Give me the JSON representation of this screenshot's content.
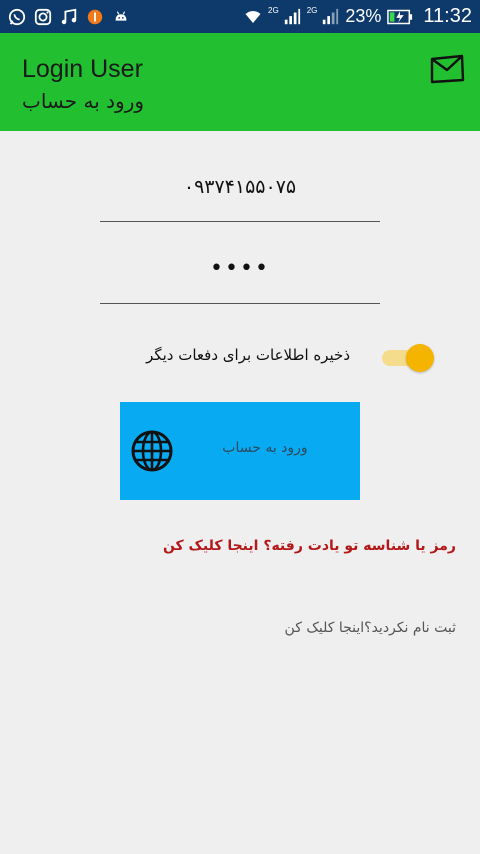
{
  "status_bar": {
    "battery_percent": "23%",
    "time": "11:32",
    "network_labels": [
      "2G",
      "2G"
    ],
    "left_icons": [
      "whatsapp-icon",
      "instagram-icon",
      "music-icon",
      "notification-badge-icon",
      "android-icon"
    ],
    "right_icons": [
      "wifi-icon",
      "signal-icon",
      "signal-icon",
      "battery-charging-icon"
    ]
  },
  "app_bar": {
    "title": "Login User",
    "subtitle": "ورود به حساب",
    "action_icon": "mail-icon",
    "color": "#22c030"
  },
  "form": {
    "phone_value": "۰۹۳۷۴۱۵۵۰۷۵",
    "password_value": "••••",
    "remember_label": "ذخیره اطلاعات برای دفعات دیگر",
    "remember_on": true,
    "login_button_label": "ورود به حساب",
    "login_button_icon": "globe-icon",
    "login_button_color": "#08aaf2"
  },
  "links": {
    "forgot": "رمز یا شناسه تو یادت رفته؟ اینجا کلیک کن",
    "register": "ثبت نام نکردید؟اینجا کلیک کن"
  }
}
